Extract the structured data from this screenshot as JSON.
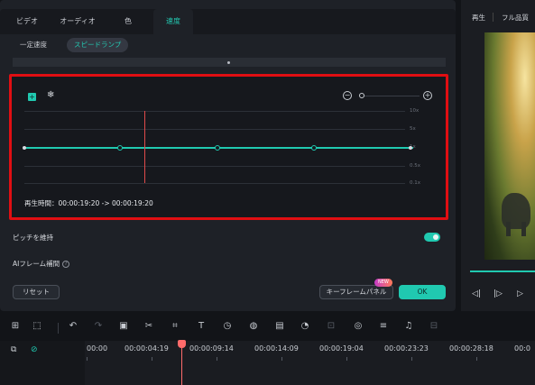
{
  "tabs": [
    "ビデオ",
    "オーディオ",
    "色",
    "速度"
  ],
  "subtabs": [
    "一定速度",
    "スピードランプ"
  ],
  "graph": {
    "add_keyframe": "+",
    "freeze": "❄",
    "zoom_minus": "−",
    "zoom_plus": "+",
    "speed_labels": [
      "10x",
      "5x",
      "1x",
      "0.5x",
      "0.1x"
    ],
    "duration_label": "再生時間：",
    "duration_value": "00:00:19:20 -> 00:00:19:20"
  },
  "options": {
    "pitch_label": "ピッチを維持",
    "ai_frame_label": "AIフレーム補間",
    "help": "?"
  },
  "buttons": {
    "reset": "リセット",
    "keyframe_panel": "キーフレームパネル",
    "new_badge": "NEW",
    "ok": "OK"
  },
  "preview": {
    "tab_play": "再生",
    "tab_quality": "フル品質",
    "controls": [
      "◁|",
      "|▷",
      "▷"
    ]
  },
  "toolbar": {
    "icons": [
      "layout-icon",
      "select-icon",
      "undo-icon",
      "redo-icon",
      "delete-icon",
      "cut-icon",
      "crop-icon",
      "text-icon",
      "speed-icon",
      "color-icon",
      "crop-zoom-icon",
      "timer-icon",
      "stabilize-icon",
      "mask-icon",
      "adjust-icon",
      "audio-icon",
      "more-icon"
    ]
  },
  "timeline": {
    "timestamps": [
      "00:00",
      "00:00:04:19",
      "00:00:09:14",
      "00:00:14:09",
      "00:00:19:04",
      "00:00:23:23",
      "00:00:28:18",
      "00:0"
    ]
  },
  "colors": {
    "accent": "#20c9b0",
    "highlight_border": "#e00e12",
    "playhead": "#ff6b6b"
  }
}
